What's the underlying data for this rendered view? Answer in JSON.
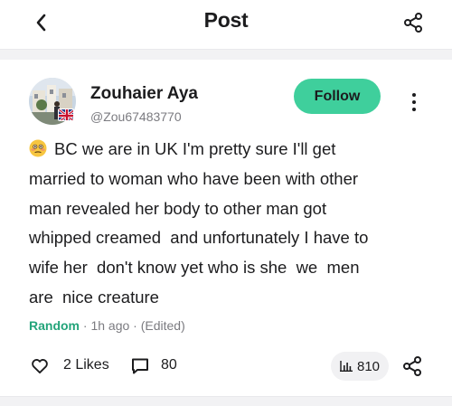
{
  "header": {
    "title": "Post",
    "back_icon": "chevron-left-icon",
    "share_icon": "share-icon"
  },
  "author": {
    "name": "Zouhaier Aya",
    "handle": "@Zou67483770",
    "follow_label": "Follow",
    "avatar_icon": "avatar",
    "flag_icon": "uk-flag-icon"
  },
  "post": {
    "emoji_icon": "flushed-face-emoji",
    "lines": [
      "BC we are in UK I'm pretty sure I'll get",
      "married to woman who have been with other",
      "man revealed her body to other man got",
      "whipped creamed  and unfortunately I have to",
      "wife her  don't know yet who is she  we  men",
      "are  nice creature"
    ]
  },
  "meta": {
    "topic": "Random",
    "time": "1h ago",
    "edited": "(Edited)",
    "separator": "·"
  },
  "actions": {
    "likes_label": "2 Likes",
    "comments_count": "80",
    "views_count": "810"
  },
  "colors": {
    "accent": "#3fcf9c",
    "topic": "#23a47a",
    "muted": "#7b7b80"
  }
}
